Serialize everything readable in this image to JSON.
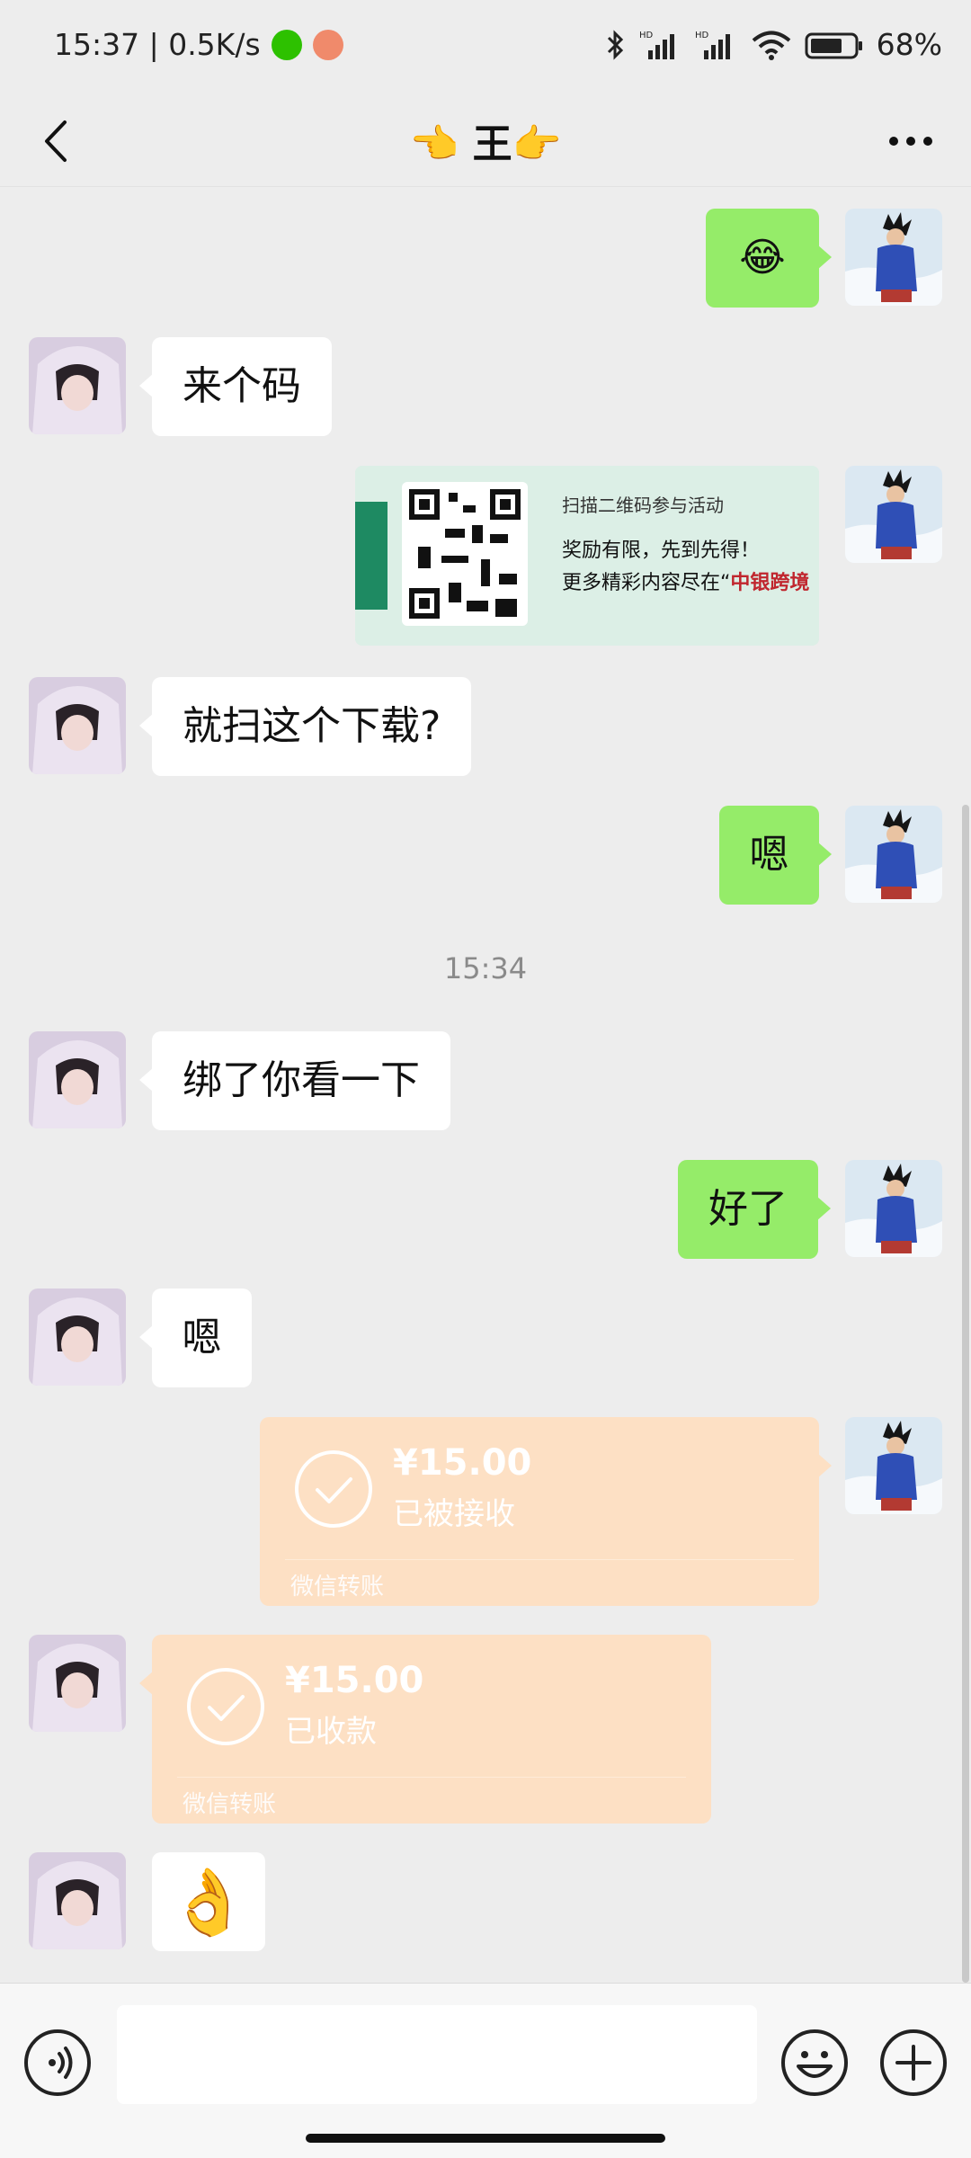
{
  "status_bar": {
    "left_text": "15:37 | 0.5K/s",
    "battery": "68%",
    "icons": [
      "wechat-icon",
      "app-icon",
      "bluetooth-icon",
      "hd-signal-icon",
      "hd-signal-icon",
      "wifi-icon",
      "battery-icon"
    ]
  },
  "nav": {
    "title": "👈 王👉"
  },
  "messages": [
    {
      "side": "right",
      "type": "sticker",
      "emoji": "😂"
    },
    {
      "side": "left",
      "type": "text",
      "text": "来个码"
    },
    {
      "side": "right",
      "type": "image",
      "image": {
        "line1": "扫描二维码参与活动",
        "line2": "奖励有限，先到先得！",
        "line3_prefix": "更多精彩内容尽在“",
        "line3_highlight": "中银跨境"
      }
    },
    {
      "side": "left",
      "type": "text",
      "text": "就扫这个下载?"
    },
    {
      "side": "right",
      "type": "text",
      "text": "嗯"
    },
    {
      "type": "timestamp",
      "text": "15:34"
    },
    {
      "side": "left",
      "type": "text",
      "text": "绑了你看一下"
    },
    {
      "side": "right",
      "type": "text",
      "text": "好了"
    },
    {
      "side": "left",
      "type": "text",
      "text": "嗯"
    },
    {
      "side": "right",
      "type": "transfer",
      "amount": "¥15.00",
      "status": "已被接收",
      "label": "微信转账"
    },
    {
      "side": "left",
      "type": "transfer",
      "amount": "¥15.00",
      "status": "已收款",
      "label": "微信转账"
    },
    {
      "side": "left",
      "type": "sticker",
      "emoji": "👌"
    }
  ],
  "input_bar": {
    "value": "",
    "icons": [
      "voice-icon",
      "emoji-icon",
      "plus-icon"
    ]
  },
  "colors": {
    "background": "#ededed",
    "bubble_me": "#95ec69",
    "bubble_friend": "#ffffff",
    "transfer": "#fde0c4"
  }
}
